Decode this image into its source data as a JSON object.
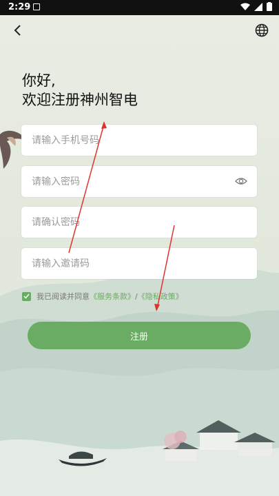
{
  "status_bar": {
    "time": "2:29"
  },
  "header": {
    "back_icon": "back-arrow-icon",
    "language_icon": "globe-icon"
  },
  "welcome": {
    "line1": "你好,",
    "line2": "欢迎注册神州智电"
  },
  "form": {
    "phone_placeholder": "请输入手机号码",
    "password_placeholder": "请输入密码",
    "confirm_placeholder": "请确认密码",
    "invite_placeholder": "请输入邀请码"
  },
  "agreement": {
    "checked": true,
    "prefix": "我已阅读并同意",
    "service_link": "《服务条款》",
    "separator": " / ",
    "privacy_link": "《隐私政策》"
  },
  "register_button": "注册",
  "colors": {
    "accent": "#6aac63",
    "annotation_arrow": "#e0322b"
  }
}
